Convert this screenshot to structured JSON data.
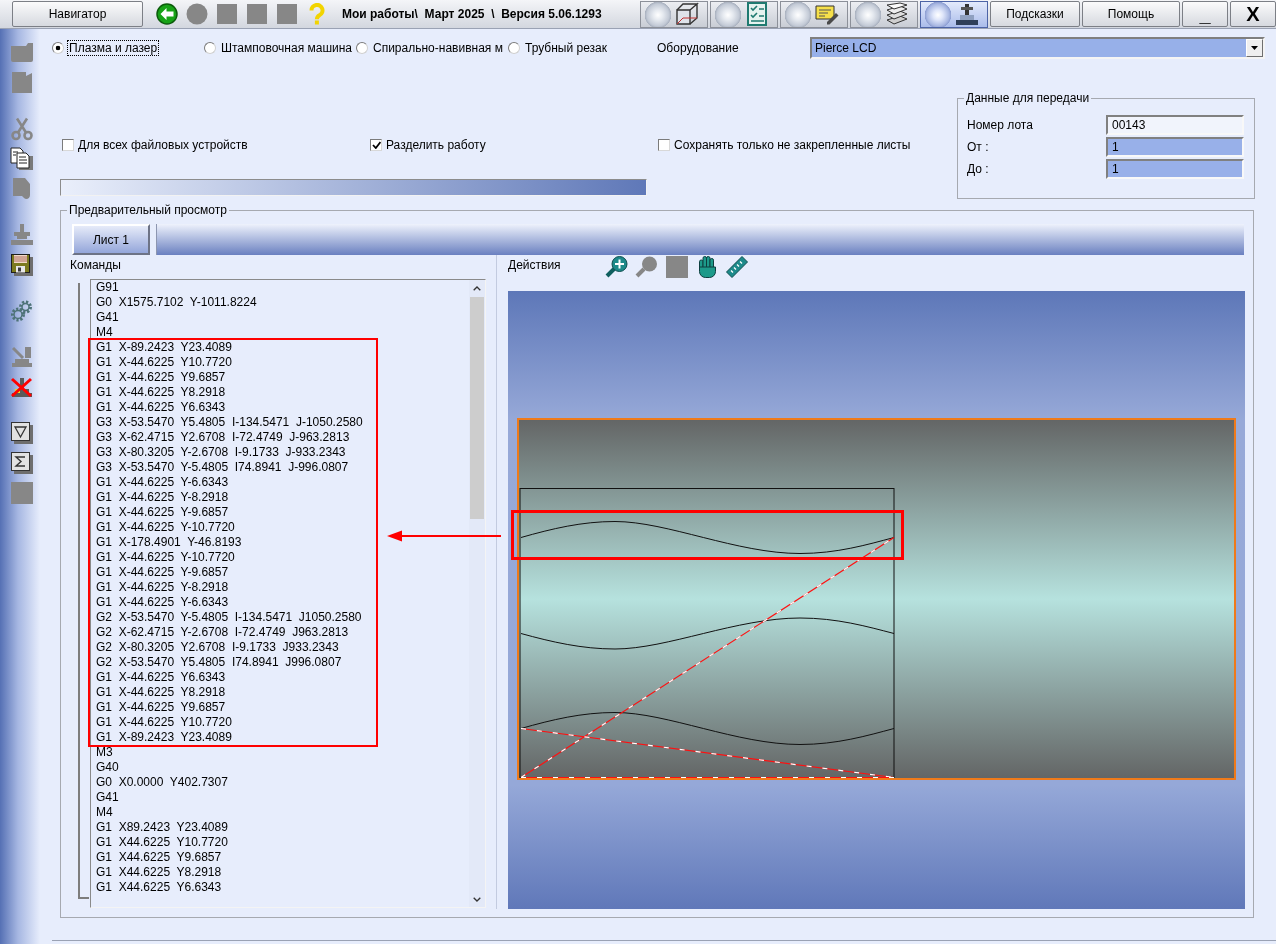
{
  "toolbar": {
    "navigator_button": "Навигатор",
    "tools": [
      {
        "disabled": false
      },
      {
        "disabled": true
      },
      {
        "disabled": true
      },
      {
        "disabled": true
      },
      {
        "disabled": true
      },
      {
        "disabled": false
      }
    ],
    "title": "Мои работы\\  Март 2025  \\  Версия 5.06.1293",
    "mode_buttons": [
      {
        "selected": false
      },
      {
        "selected": false
      },
      {
        "selected": false
      },
      {
        "selected": false
      },
      {
        "selected": true
      }
    ],
    "hints_button": "Подсказки",
    "help_button": "Помощь",
    "minimize_button": "_",
    "close_button": "X"
  },
  "sidebar": {
    "tools": [
      {
        "disabled": true
      },
      {
        "disabled": true
      },
      {
        "disabled": true
      },
      {
        "disabled": false
      },
      {
        "disabled": true
      },
      {
        "disabled": true
      },
      {
        "disabled": false
      },
      {
        "disabled": false
      },
      {
        "disabled": true
      },
      {
        "disabled": false
      },
      {
        "disabled": false
      },
      {
        "disabled": false
      },
      {
        "disabled": true
      }
    ]
  },
  "machine_types": [
    {
      "label": "Плазма и лазер",
      "selected": true,
      "focused": true
    },
    {
      "label": "Штамповочная машина",
      "selected": false,
      "focused": false
    },
    {
      "label": "Спирально-навивная м",
      "selected": false,
      "focused": false
    },
    {
      "label": "Трубный резак",
      "selected": false,
      "focused": false
    }
  ],
  "equipment": {
    "label": "Оборудование",
    "value": "Pierce LCD"
  },
  "options": [
    {
      "label": "Для всех файловых устройств",
      "checked": false
    },
    {
      "label": "Разделить работу",
      "checked": true
    },
    {
      "label": "Сохранять только не закрепленные листы",
      "checked": false
    }
  ],
  "progress": {
    "level": 1
  },
  "transfer": {
    "title": "Данные для передачи",
    "fields": [
      {
        "label": "Номер лота",
        "value": "00143",
        "readonly": true
      },
      {
        "label": "От :",
        "value": "1",
        "readonly": false
      },
      {
        "label": "До :",
        "value": "1",
        "readonly": false
      }
    ]
  },
  "preview": {
    "title": "Предварительный просмотр",
    "tabs": [
      {
        "label": "Лист 1",
        "selected": true
      }
    ],
    "commands": {
      "title": "Команды",
      "blocks": [
        {
          "marked": false,
          "lines": [
            "G91",
            "G0  X1575.7102  Y-1011.8224",
            "G41",
            "M4"
          ]
        },
        {
          "marked": true,
          "lines": [
            "G1  X-89.2423  Y23.4089",
            "G1  X-44.6225  Y10.7720",
            "G1  X-44.6225  Y9.6857",
            "G1  X-44.6225  Y8.2918",
            "G1  X-44.6225  Y6.6343",
            "G3  X-53.5470  Y5.4805  I-134.5471  J-1050.2580",
            "G3  X-62.4715  Y2.6708  I-72.4749  J-963.2813",
            "G3  X-80.3205  Y-2.6708  I-9.1733  J-933.2343",
            "G3  X-53.5470  Y-5.4805  I74.8941  J-996.0807",
            "G1  X-44.6225  Y-6.6343",
            "G1  X-44.6225  Y-8.2918",
            "G1  X-44.6225  Y-9.6857",
            "G1  X-44.6225  Y-10.7720",
            "G1  X-178.4901  Y-46.8193",
            "G1  X-44.6225  Y-10.7720",
            "G1  X-44.6225  Y-9.6857",
            "G1  X-44.6225  Y-8.2918",
            "G1  X-44.6225  Y-6.6343",
            "G2  X-53.5470  Y-5.4805  I-134.5471  J1050.2580",
            "G2  X-62.4715  Y-2.6708  I-72.4749  J963.2813",
            "G2  X-80.3205  Y2.6708  I-9.1733  J933.2343",
            "G2  X-53.5470  Y5.4805  I74.8941  J996.0807",
            "G1  X-44.6225  Y6.6343",
            "G1  X-44.6225  Y8.2918",
            "G1  X-44.6225  Y9.6857",
            "G1  X-44.6225  Y10.7720",
            "G1  X-89.2423  Y23.4089"
          ]
        },
        {
          "marked": false,
          "lines": [
            "M3",
            "G40",
            "G0  X0.0000  Y402.7307",
            "G41",
            "M4",
            "G1  X89.2423  Y23.4089",
            "G1  X44.6225  Y10.7720",
            "G1  X44.6225  Y9.6857",
            "G1  X44.6225  Y8.2918",
            "G1  X44.6225  Y6.6343"
          ]
        }
      ]
    },
    "actions": {
      "title": "Действия",
      "tools": [
        {
          "disabled": false
        },
        {
          "disabled": true
        },
        {
          "disabled": true
        },
        {
          "disabled": false
        },
        {
          "disabled": false
        }
      ]
    }
  }
}
